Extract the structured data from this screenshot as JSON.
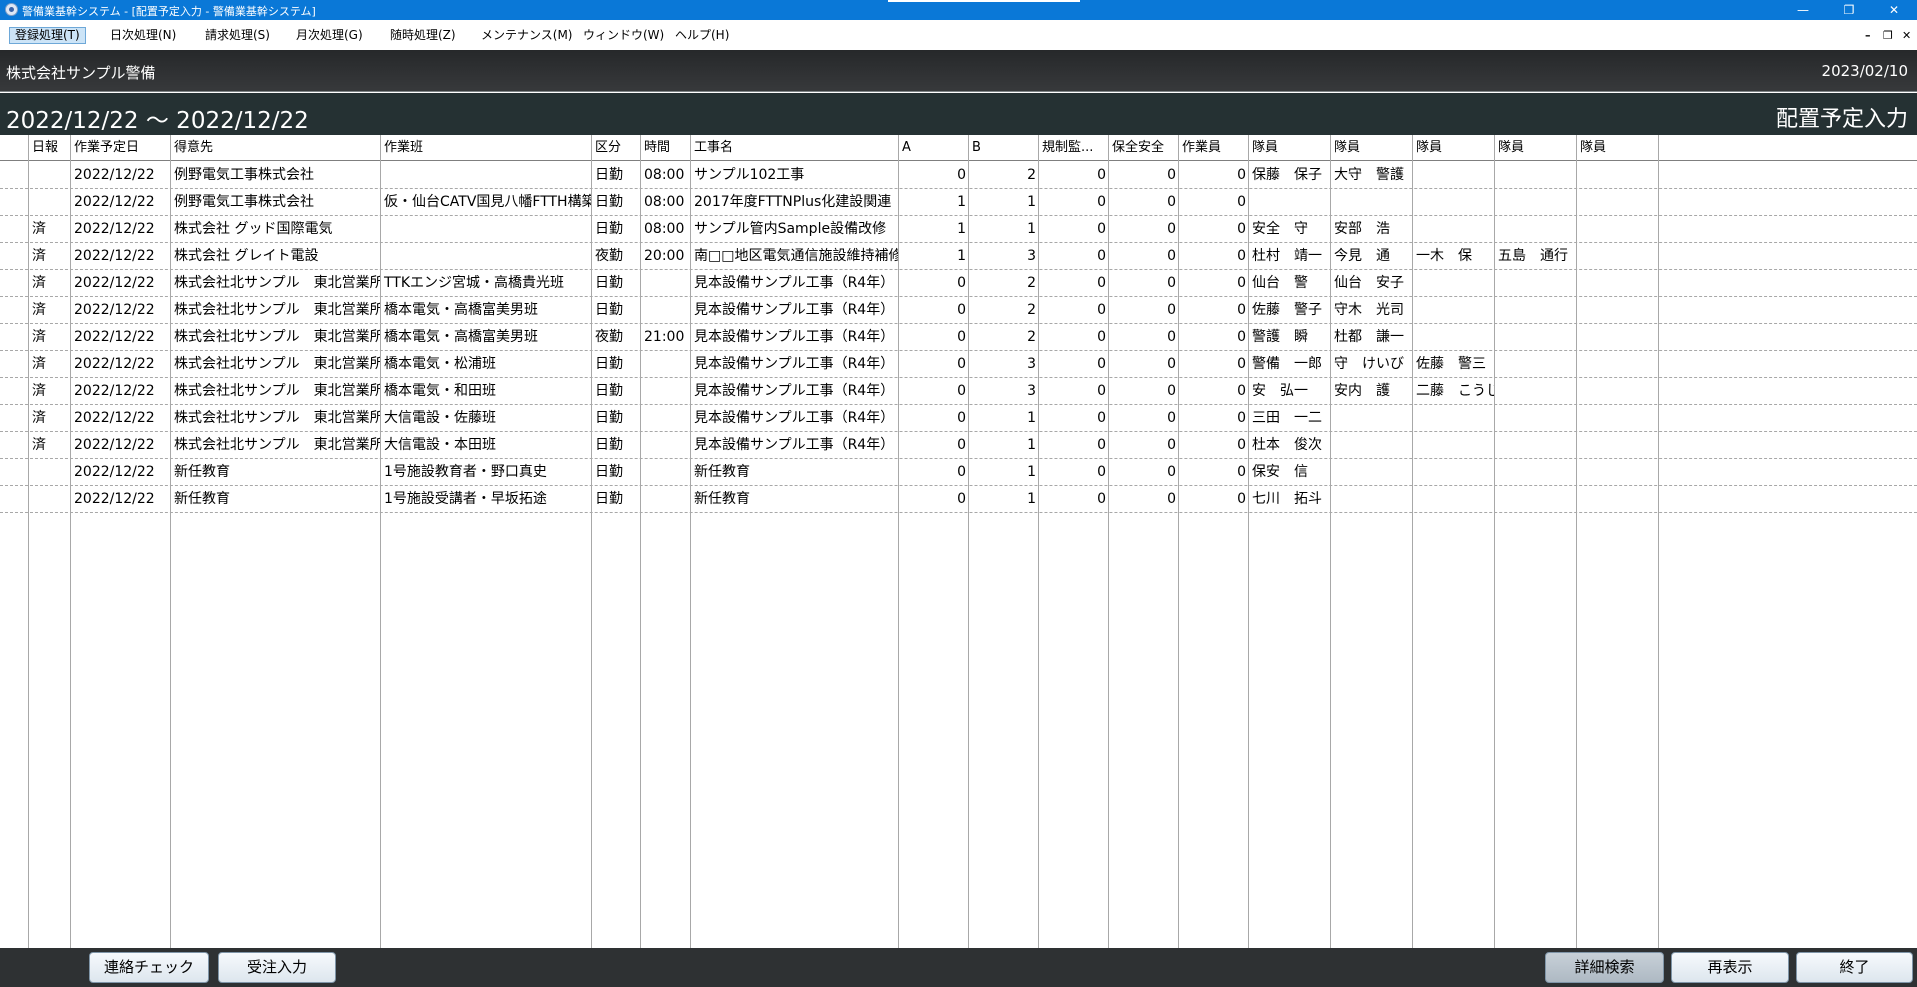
{
  "window": {
    "title": "警備業基幹システム - [配置予定入力 - 警備業基幹システム]",
    "minimize": "—",
    "maximize": "❐",
    "close": "✕"
  },
  "menu": {
    "items": [
      {
        "label": "登録処理(T)"
      },
      {
        "label": "日次処理(N)"
      },
      {
        "label": "請求処理(S)"
      },
      {
        "label": "月次処理(G)"
      },
      {
        "label": "随時処理(Z)"
      },
      {
        "label": "メンテナンス(M)"
      },
      {
        "label": "ウィンドウ(W)"
      },
      {
        "label": "ヘルプ(H)"
      }
    ],
    "mdi_minimize": "–",
    "mdi_restore": "❐",
    "mdi_close": "✕"
  },
  "header": {
    "company": "株式会社サンプル警備",
    "date": "2023/02/10",
    "range": "2022/12/22 ～ 2022/12/22",
    "screen_title": "配置予定入力"
  },
  "table": {
    "columns": [
      "",
      "日報",
      "作業予定日",
      "得意先",
      "作業班",
      "区分",
      "時間",
      "工事名",
      "A",
      "B",
      "規制監...",
      "保全安全",
      "作業員",
      "隊員",
      "隊員",
      "隊員",
      "隊員",
      "隊員"
    ],
    "rows": [
      [
        "",
        "",
        "2022/12/22",
        "例野電気工事株式会社",
        "",
        "日勤",
        "08:00",
        "サンプル102工事",
        "0",
        "2",
        "0",
        "0",
        "0",
        "保藤　保子",
        "大守　警護",
        "",
        "",
        ""
      ],
      [
        "",
        "",
        "2022/12/22",
        "例野電気工事株式会社",
        "仮・仙台CATV国見八幡FTTH構築工事",
        "日勤",
        "08:00",
        "2017年度FTTNPlus化建設関連",
        "1",
        "1",
        "0",
        "0",
        "0",
        "",
        "",
        "",
        "",
        ""
      ],
      [
        "",
        "済",
        "2022/12/22",
        "株式会社 グッド国際電気",
        "",
        "日勤",
        "08:00",
        "サンプル管内Sample設備改修",
        "1",
        "1",
        "0",
        "0",
        "0",
        "安全　守",
        "安部　浩",
        "",
        "",
        ""
      ],
      [
        "",
        "済",
        "2022/12/22",
        "株式会社 グレイト電設",
        "",
        "夜勤",
        "20:00",
        "南□□地区電気通信施設維持補修",
        "1",
        "3",
        "0",
        "0",
        "0",
        "杜村　靖一",
        "今見　通",
        "一木　保",
        "五島　通行",
        ""
      ],
      [
        "",
        "済",
        "2022/12/22",
        "株式会社北サンプル　東北営業所",
        "TTKエンジ宮城・高橋貴光班",
        "日勤",
        "",
        "見本設備サンプル工事（R4年）",
        "0",
        "2",
        "0",
        "0",
        "0",
        "仙台　警",
        "仙台　安子",
        "",
        "",
        ""
      ],
      [
        "",
        "済",
        "2022/12/22",
        "株式会社北サンプル　東北営業所",
        "橋本電気・高橋富美男班",
        "日勤",
        "",
        "見本設備サンプル工事（R4年）",
        "0",
        "2",
        "0",
        "0",
        "0",
        "佐藤　警子",
        "守木　光司",
        "",
        "",
        ""
      ],
      [
        "",
        "済",
        "2022/12/22",
        "株式会社北サンプル　東北営業所",
        "橋本電気・高橋富美男班",
        "夜勤",
        "21:00",
        "見本設備サンプル工事（R4年）",
        "0",
        "2",
        "0",
        "0",
        "0",
        "警護　瞬",
        "杜都　謙一",
        "",
        "",
        ""
      ],
      [
        "",
        "済",
        "2022/12/22",
        "株式会社北サンプル　東北営業所",
        "橋本電気・松浦班",
        "日勤",
        "",
        "見本設備サンプル工事（R4年）",
        "0",
        "3",
        "0",
        "0",
        "0",
        "警備　一郎",
        "守　けいび",
        "佐藤　警三",
        "",
        ""
      ],
      [
        "",
        "済",
        "2022/12/22",
        "株式会社北サンプル　東北営業所",
        "橋本電気・和田班",
        "日勤",
        "",
        "見本設備サンプル工事（R4年）",
        "0",
        "3",
        "0",
        "0",
        "0",
        "安　弘一",
        "安内　護",
        "二藤　こうじ",
        "",
        ""
      ],
      [
        "",
        "済",
        "2022/12/22",
        "株式会社北サンプル　東北営業所",
        "大信電設・佐藤班",
        "日勤",
        "",
        "見本設備サンプル工事（R4年）",
        "0",
        "1",
        "0",
        "0",
        "0",
        "三田　一二",
        "",
        "",
        "",
        ""
      ],
      [
        "",
        "済",
        "2022/12/22",
        "株式会社北サンプル　東北営業所",
        "大信電設・本田班",
        "日勤",
        "",
        "見本設備サンプル工事（R4年）",
        "0",
        "1",
        "0",
        "0",
        "0",
        "杜本　俊次",
        "",
        "",
        "",
        ""
      ],
      [
        "",
        "",
        "2022/12/22",
        "新任教育",
        "1号施設教育者・野口真史",
        "日勤",
        "",
        "新任教育",
        "0",
        "1",
        "0",
        "0",
        "0",
        "保安　信",
        "",
        "",
        "",
        ""
      ],
      [
        "",
        "",
        "2022/12/22",
        "新任教育",
        "1号施設受講者・早坂拓途",
        "日勤",
        "",
        "新任教育",
        "0",
        "1",
        "0",
        "0",
        "0",
        "七川　拓斗",
        "",
        "",
        "",
        ""
      ]
    ]
  },
  "buttons": {
    "contact_check": "連絡チェック",
    "order_entry": "受注入力",
    "detail_search": "詳細検索",
    "redisplay": "再表示",
    "exit": "終了"
  }
}
